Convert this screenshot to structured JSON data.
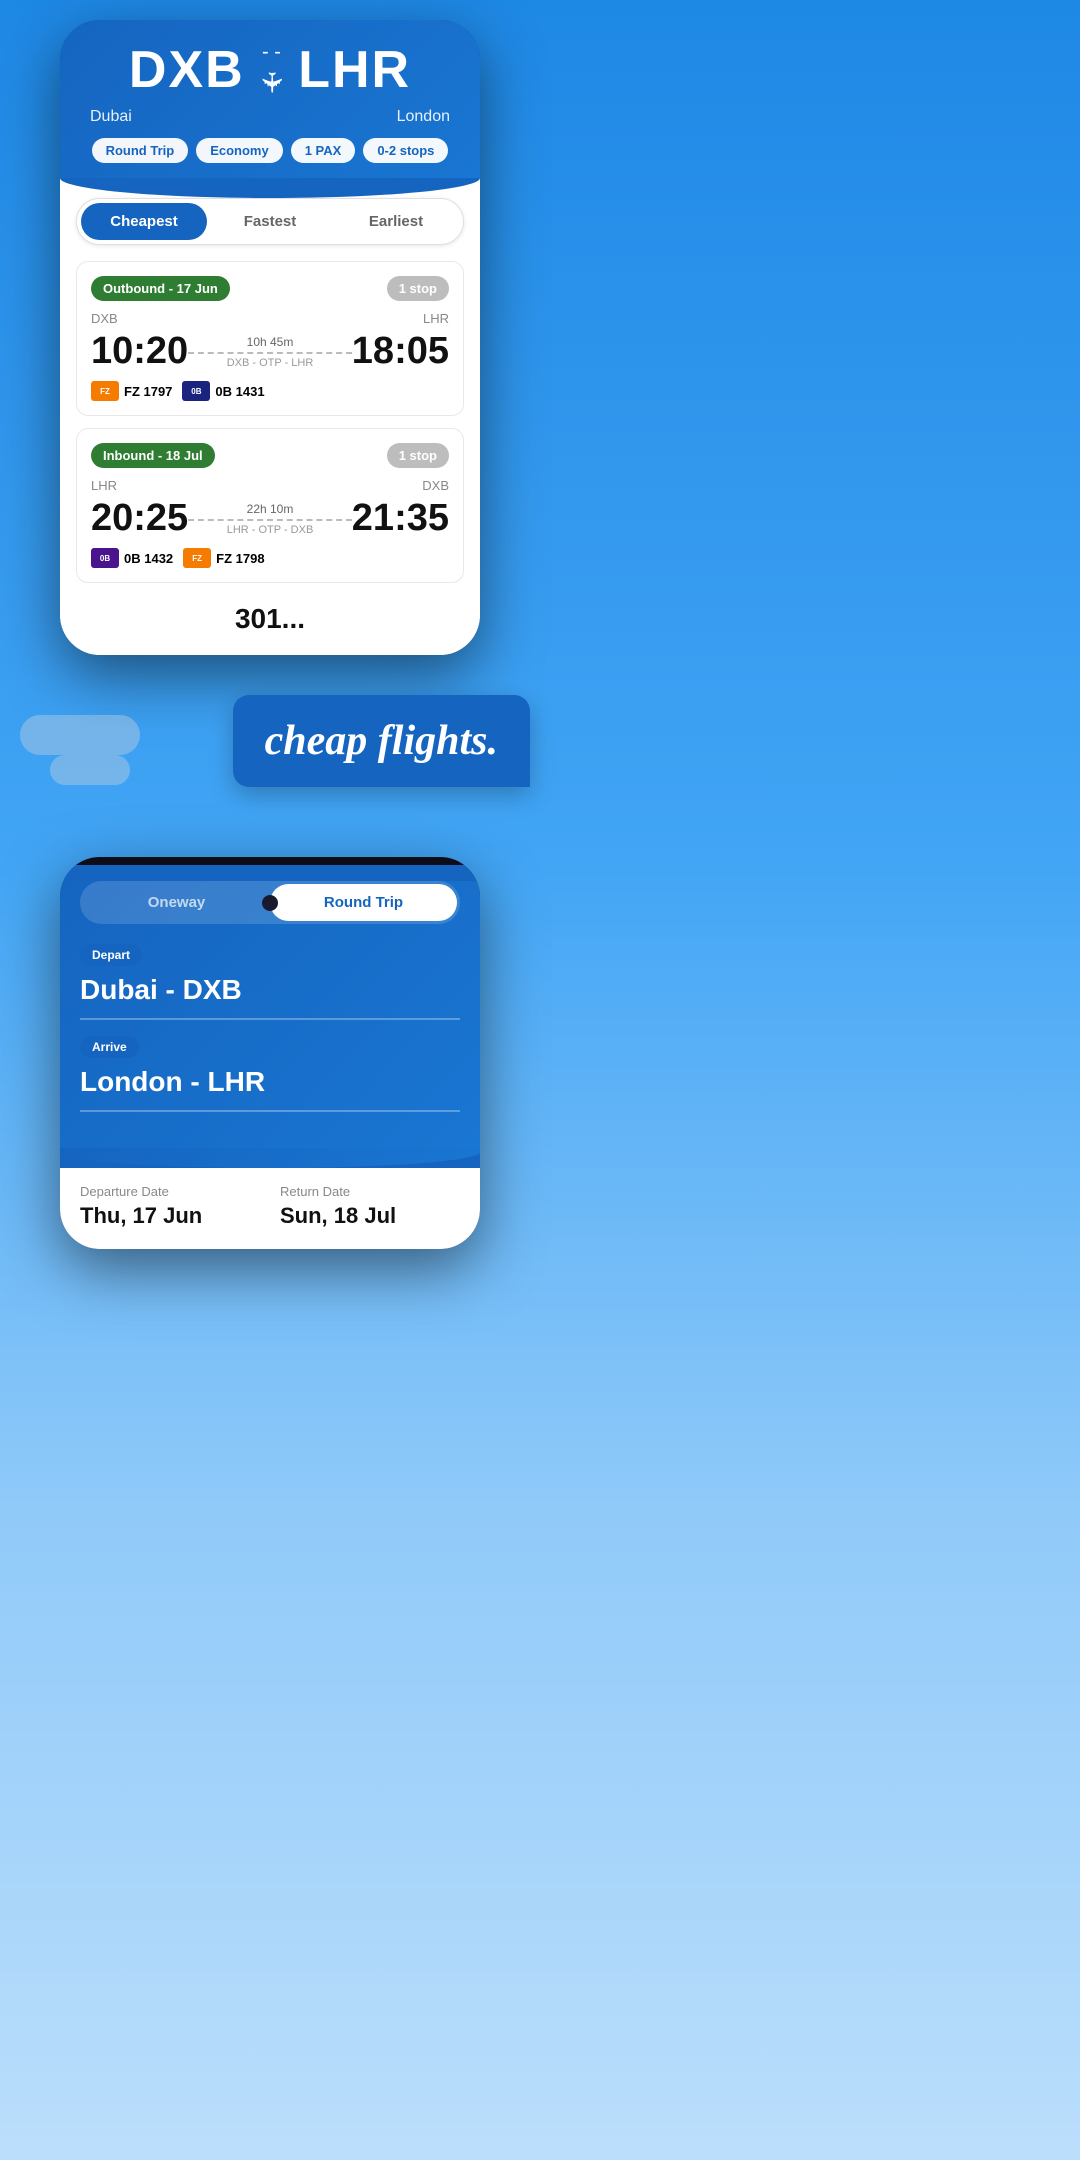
{
  "page": {
    "background_color": "#2196f3"
  },
  "phone1": {
    "origin_code": "DXB",
    "origin_name": "Dubai",
    "dest_code": "LHR",
    "dest_name": "London",
    "tags": [
      "Round Trip",
      "Economy",
      "1 PAX",
      "0-2 stops"
    ],
    "tabs": [
      "Cheapest",
      "Fastest",
      "Earliest"
    ],
    "active_tab": "Cheapest",
    "outbound": {
      "label": "Outbound - 17 Jun",
      "stops": "1 stop",
      "from": "DXB",
      "to": "LHR",
      "depart": "10:20",
      "arrive": "18:05",
      "duration": "10h 45m",
      "via": "DXB - OTP - LHR",
      "flights": [
        "FZ 1797",
        "0B 1431"
      ],
      "logos": [
        "orange",
        "blue"
      ]
    },
    "inbound": {
      "label": "Inbound - 18 Jul",
      "stops": "1 stop",
      "from": "LHR",
      "to": "DXB",
      "depart": "20:25",
      "arrive": "21:35",
      "duration": "22h 10m",
      "via": "LHR - OTP - DXB",
      "flights": [
        "0B 1432",
        "FZ 1798"
      ],
      "logos": [
        "purple",
        "orange"
      ]
    }
  },
  "cheap_flights": {
    "text": "cheap flights."
  },
  "phone2": {
    "trip_options": [
      "Oneway",
      "Round Trip"
    ],
    "active_trip": "Round Trip",
    "depart_label": "Depart",
    "depart_value": "Dubai - DXB",
    "arrive_label": "Arrive",
    "arrive_value": "London - LHR",
    "departure_date_label": "Departure Date",
    "departure_date_value": "Thu, 17 Jun",
    "return_date_label": "Return Date",
    "return_date_value": "Sun, 18 Jul"
  }
}
